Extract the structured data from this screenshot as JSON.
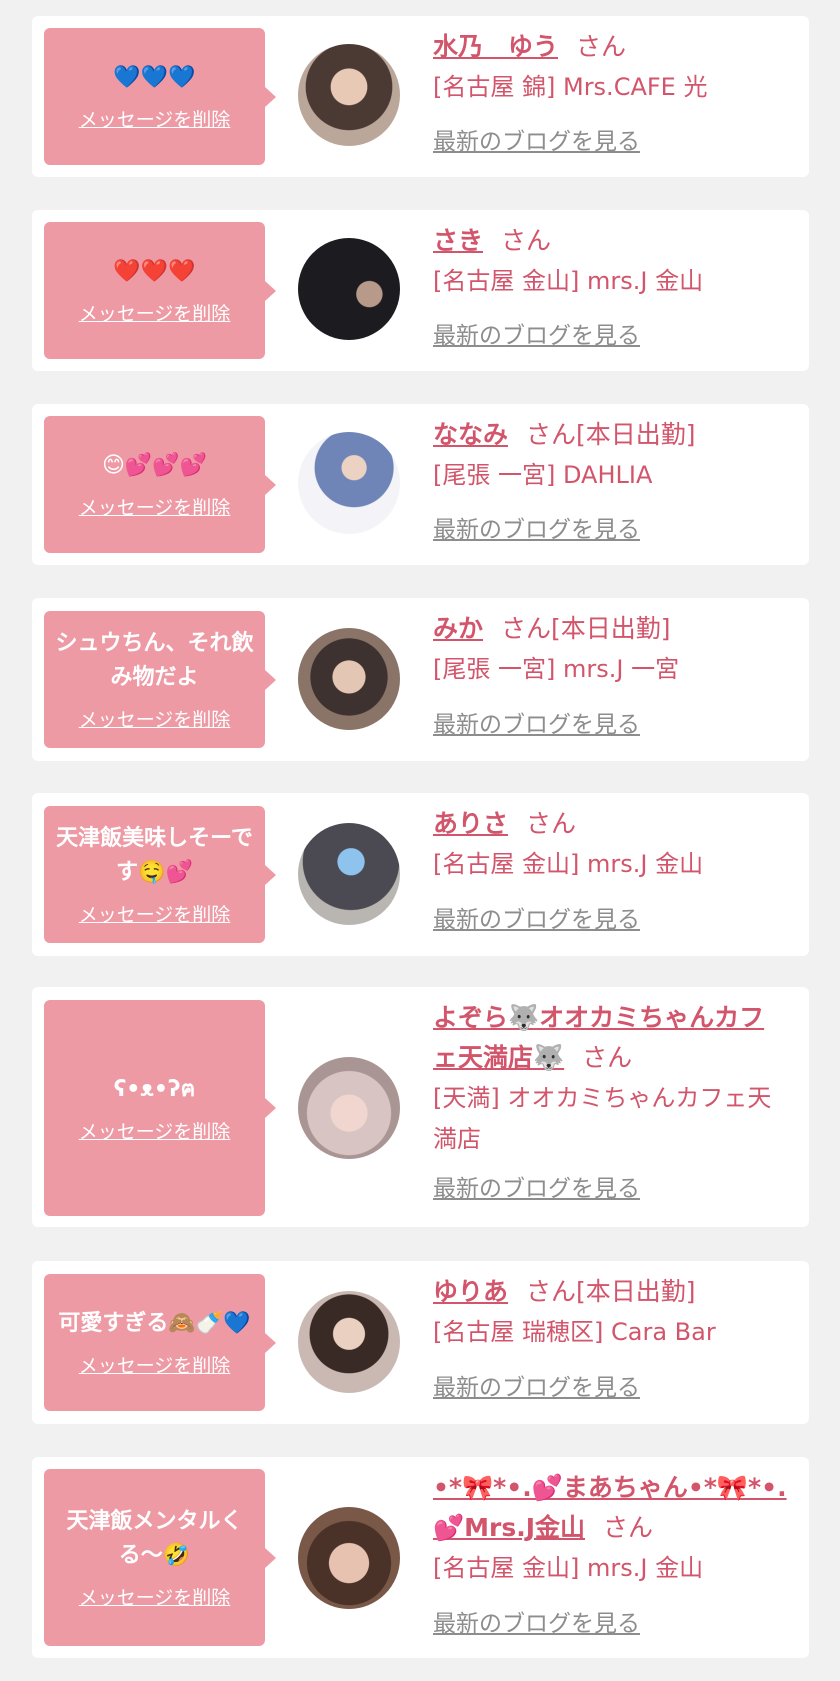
{
  "labels": {
    "delete": "メッセージを削除",
    "blog": "最新のブログを見る"
  },
  "colors": {
    "background": "#f1f1f1",
    "card": "#ffffff",
    "bubble": "#ee9aa5",
    "accent": "#d2556b",
    "link_gray": "#8d8d8d"
  },
  "entries": [
    {
      "message": "💙💙💙",
      "name": "水乃　ゆう",
      "suffix": "さん",
      "shop": "[名古屋 錦] Mrs.CAFE 光"
    },
    {
      "message": "❤️❤️❤️",
      "name": "さき",
      "suffix": "さん",
      "shop": "[名古屋 金山] mrs.J 金山"
    },
    {
      "message": "😊💕💕💕",
      "name": "ななみ",
      "suffix": "さん[本日出勤]",
      "shop": "[尾張 一宮] DAHLIA"
    },
    {
      "message": "シュウちん、それ飲み物だよ",
      "name": "みか",
      "suffix": "さん[本日出勤]",
      "shop": "[尾張 一宮] mrs.J 一宮"
    },
    {
      "message": "天津飯美味しそーです🤤💕",
      "name": "ありさ",
      "suffix": "さん",
      "shop": "[名古屋 金山] mrs.J 金山"
    },
    {
      "message": "ʕ•ᴥ•ʔฅ",
      "name": "よぞら🐺オオカミちゃんカフェ天満店🐺",
      "suffix": "さん",
      "shop": "[天満] オオカミちゃんカフェ天満店"
    },
    {
      "message": "可愛すぎる🙈🍼💙",
      "name": "ゆりあ",
      "suffix": "さん[本日出勤]",
      "shop": "[名古屋 瑞穂区] Cara Bar"
    },
    {
      "message": "天津飯メンタルくる〜🤣",
      "name": "•*🎀*•.💕まあちゃん•*🎀*•.💕Mrs.J金山",
      "suffix": "さん",
      "shop": "[名古屋 金山] mrs.J 金山"
    }
  ]
}
